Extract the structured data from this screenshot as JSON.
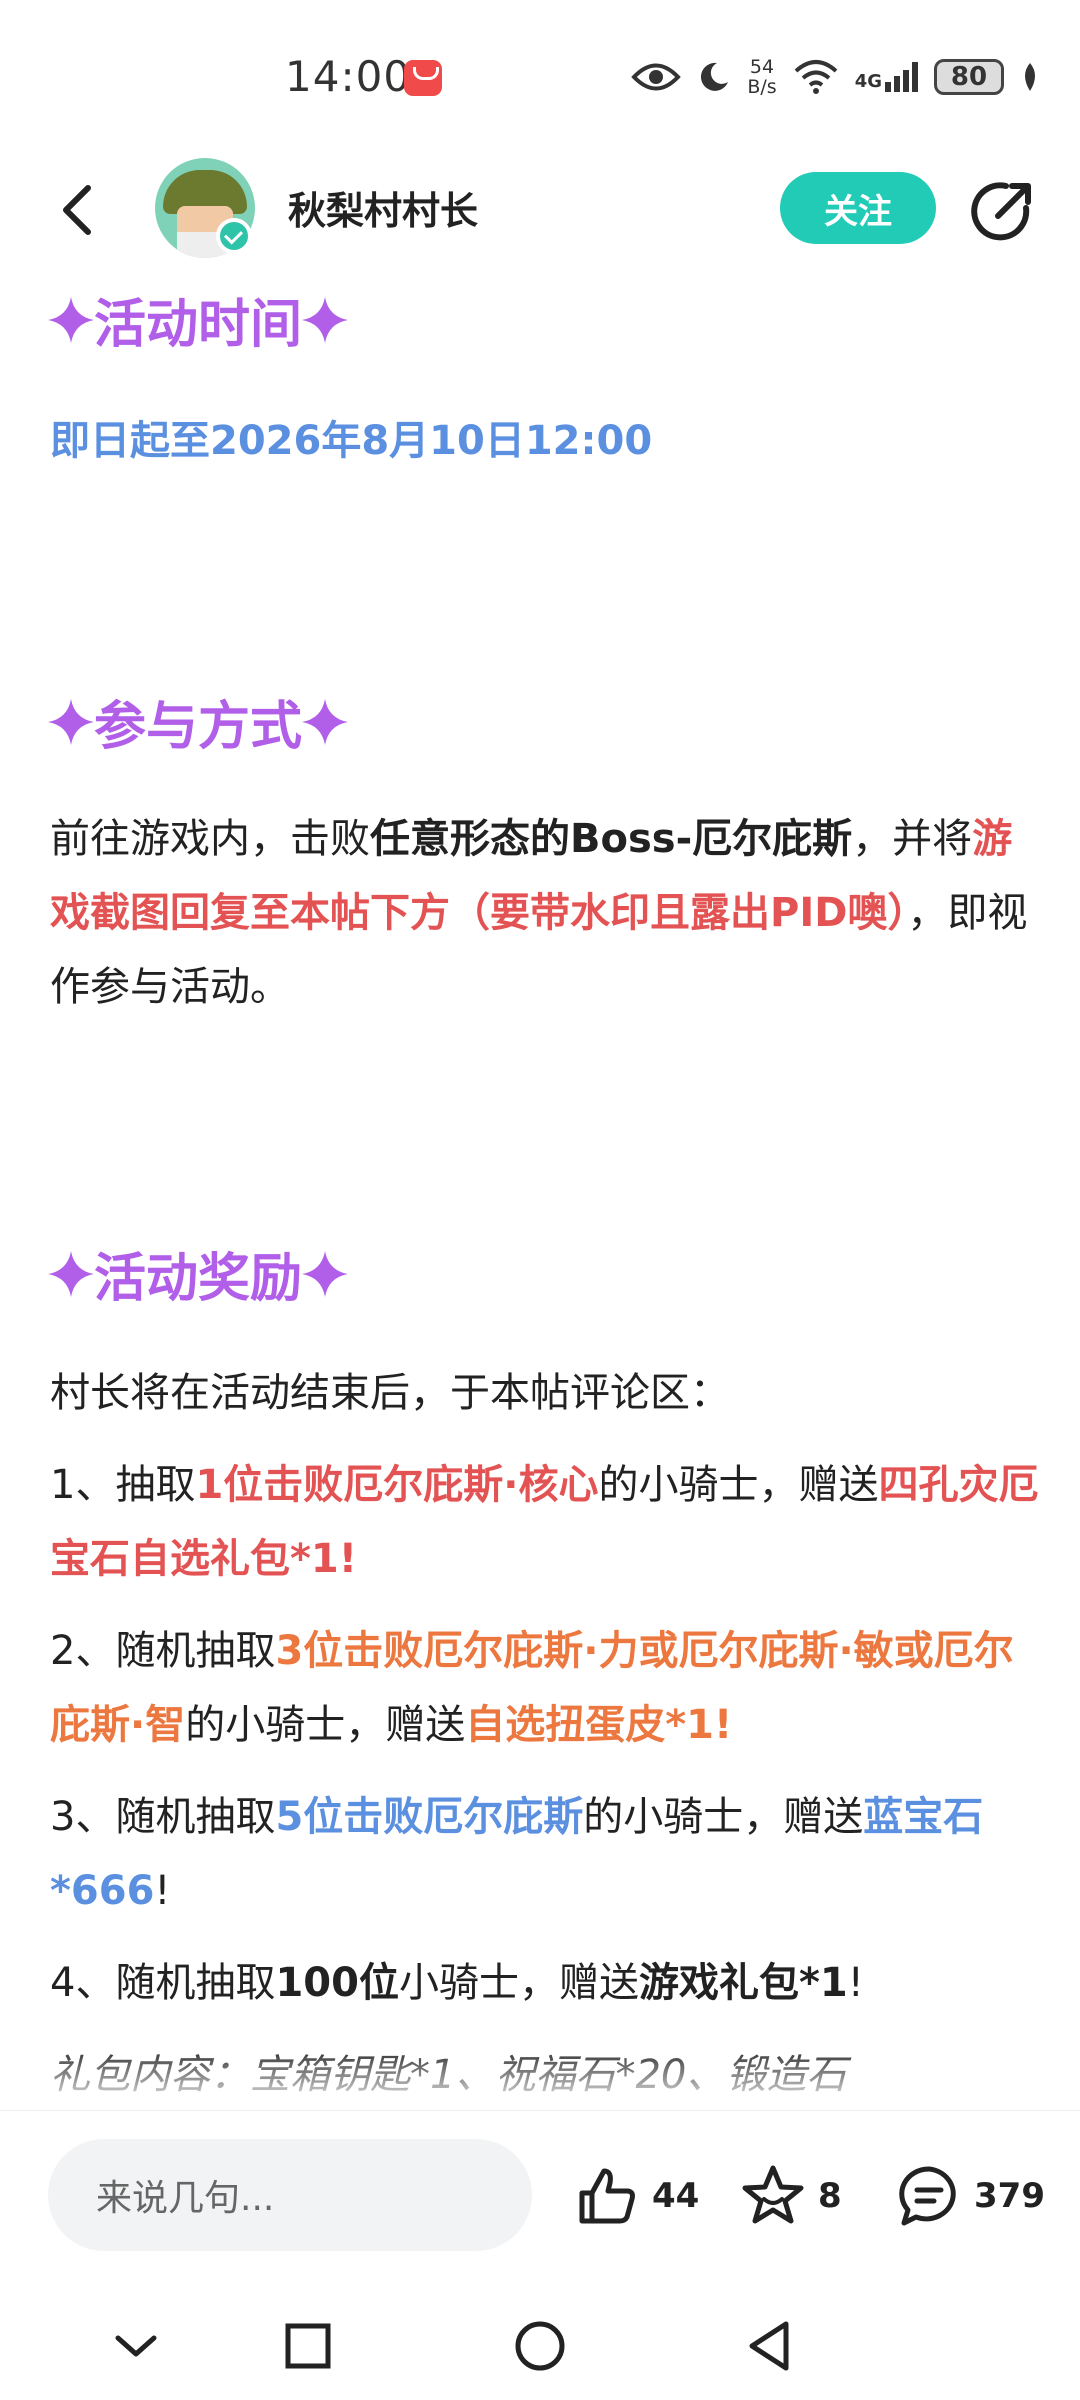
{
  "status_bar": {
    "time": "14:00",
    "net_speed_value": "54",
    "net_speed_unit": "B/s",
    "network_type": "4G",
    "battery": "80"
  },
  "header": {
    "username": "秋梨村村长",
    "follow_label": "关注"
  },
  "post": {
    "section1_title": "活动时间",
    "activity_time": "即日起至2026年8月10日12:00",
    "section2_title": "参与方式",
    "participation": {
      "p1": "前往游戏内，击败",
      "p2": "任意形态的Boss-厄尔庇斯",
      "p3": "，并将",
      "p4": "游戏截图回复至本帖下方（要带水印且露出PID噢）",
      "p5": "，即视作参与活动。"
    },
    "section3_title": "活动奖励",
    "reward_intro": "村长将在活动结束后，于本帖评论区：",
    "reward1": {
      "a": "1、抽取",
      "b": "1位击败厄尔庇斯·核心",
      "c": "的小骑士，赠送",
      "d": "四孔灾厄宝石自选礼包*1!"
    },
    "reward2": {
      "a": "2、随机抽取",
      "b": "3位击败厄尔庇斯·力或厄尔庇斯·敏或厄尔庇斯·智",
      "c": "的小骑士，赠送",
      "d": "自选扭蛋皮*1!"
    },
    "reward3": {
      "a": "3、随机抽取",
      "b": "5位击败厄尔庇斯",
      "c": "的小骑士，赠送",
      "d": "蓝宝石*666",
      "e": "!"
    },
    "reward4": {
      "a": "4、随机抽取",
      "b": "100位",
      "c": "小骑士，赠送",
      "d": "游戏礼包*1",
      "e": "!"
    },
    "gift_content": "礼包内容：宝箱钥匙*1、祝福石*20、锻造石"
  },
  "bottom_bar": {
    "comment_placeholder": "来说几句...",
    "likes": "44",
    "favorites": "8",
    "comments": "379"
  },
  "colors": {
    "title_purple": "#b15ee8",
    "link_blue": "#5b8fe0",
    "highlight_red": "#e45353",
    "highlight_orange": "#ec7840",
    "follow_teal": "#22cbb5"
  }
}
